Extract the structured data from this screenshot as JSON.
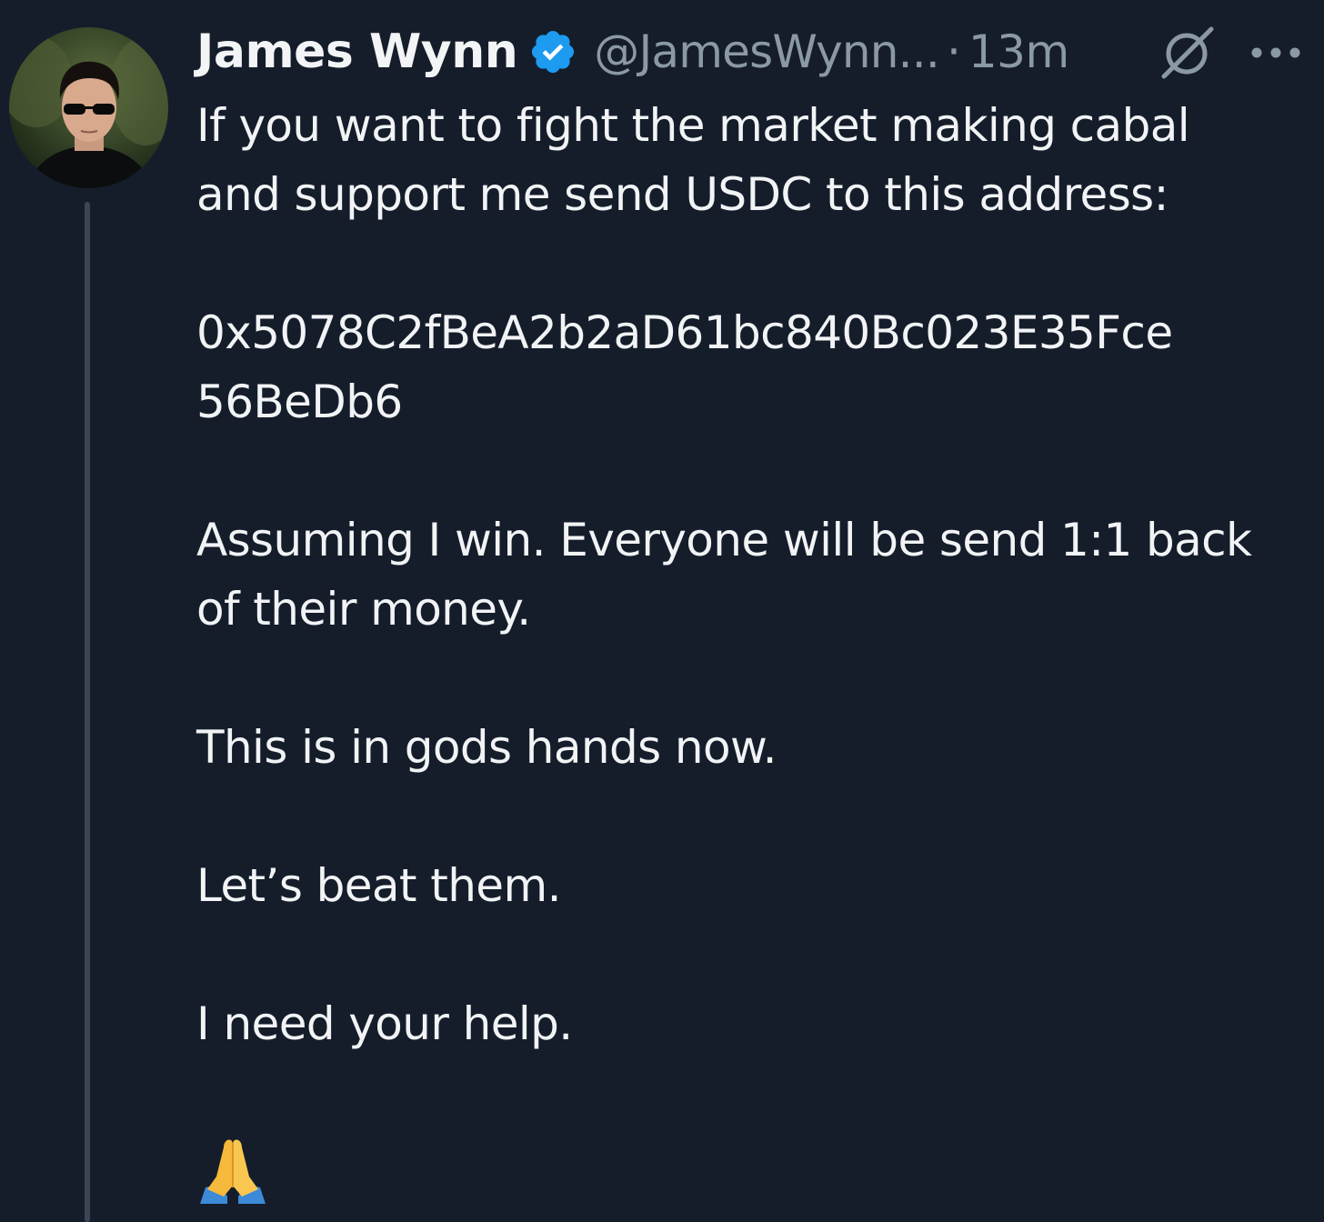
{
  "tweet": {
    "author_name": "James Wynn",
    "handle": "@JamesWynn...",
    "separator": "·",
    "time": "13m",
    "verified": true,
    "body": {
      "line1": "If you want to fight the market making cabal",
      "line2": "and support me send USDC to this address:",
      "address_line1": "0x5078C2fBeA2b2aD61bc840Bc023E35Fce",
      "address_line2": "56BeDb6",
      "line3": "Assuming I win. Everyone will be send 1:1 back",
      "line4": "of their money.",
      "line5": "This is in gods hands now.",
      "line6": "Let’s beat them.",
      "line7": "I need your help."
    },
    "emoji": "folded-hands"
  },
  "colors": {
    "background": "#151d2b",
    "text_primary": "#f1f3f5",
    "text_secondary": "#8b98a5",
    "verified_blue": "#1d9bf0",
    "thread_line": "#3a4656"
  },
  "icons": {
    "verified": "verified-badge-icon",
    "grok": "grok-icon",
    "more": "more-options-icon"
  }
}
